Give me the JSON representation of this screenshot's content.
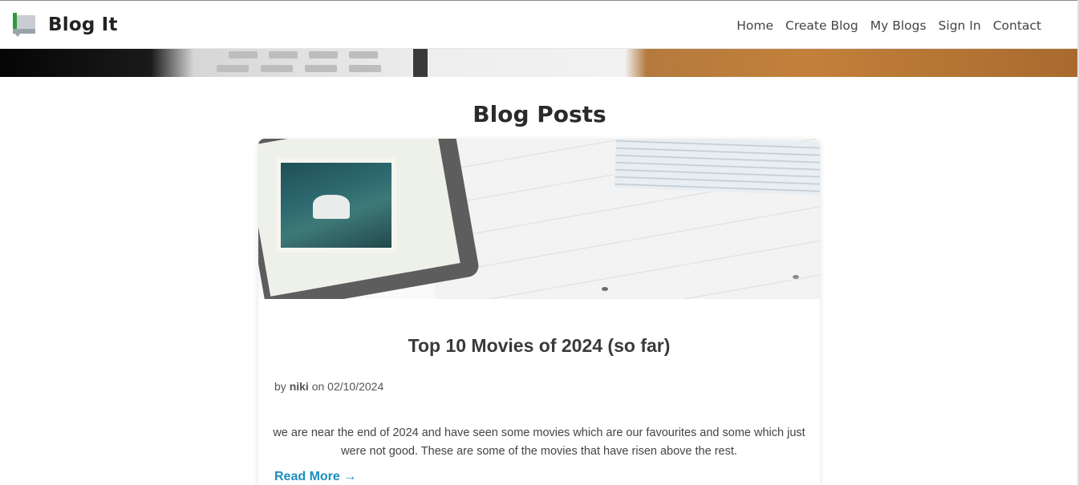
{
  "navbar": {
    "brand": "Blog It",
    "links": [
      "Home",
      "Create Blog",
      "My Blogs",
      "Sign In",
      "Contact"
    ]
  },
  "main": {
    "heading": "Blog Posts"
  },
  "post": {
    "title": "Top 10 Movies of 2024 (so far)",
    "by_label": "by",
    "author": "niki",
    "on_label": "on",
    "date": "02/10/2024",
    "excerpt": "we are near the end of 2024 and have seen some movies which are our favourites and some which just were not good. These are some of the movies that have risen above the rest.",
    "read_more": "Read More →"
  },
  "colors": {
    "accent_link": "#1a8fc0",
    "logo_green": "#2e9a3b"
  },
  "icons": {
    "brand_logo": "blog-logo-icon"
  }
}
